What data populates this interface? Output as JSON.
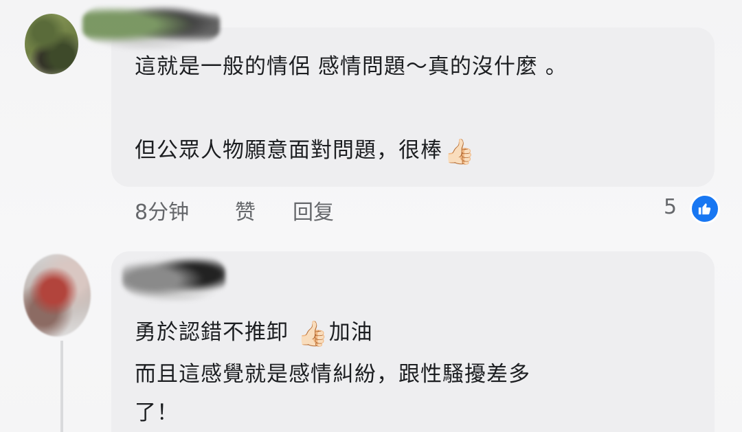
{
  "comments": [
    {
      "text_line1": "這就是一般的情侶 感情問題～真的沒什麼 。",
      "text_line2": "但公眾人物願意面對問題，很棒",
      "emoji": "👍🏻",
      "time": "8分钟",
      "like_label": "赞",
      "reply_label": "回复",
      "reaction_count": "5",
      "reaction_icon": "like-icon"
    },
    {
      "text_line1_a": "勇於認錯不推卸",
      "emoji": "👍🏻",
      "text_line1_b": "加油",
      "text_line2": "而且這感覺就是感情糾紛，跟性騷擾差多",
      "text_line3": "了！"
    }
  ],
  "colors": {
    "bubble": "#eeeef0",
    "meta_text": "#65676b",
    "like_badge": "#1877f2"
  }
}
